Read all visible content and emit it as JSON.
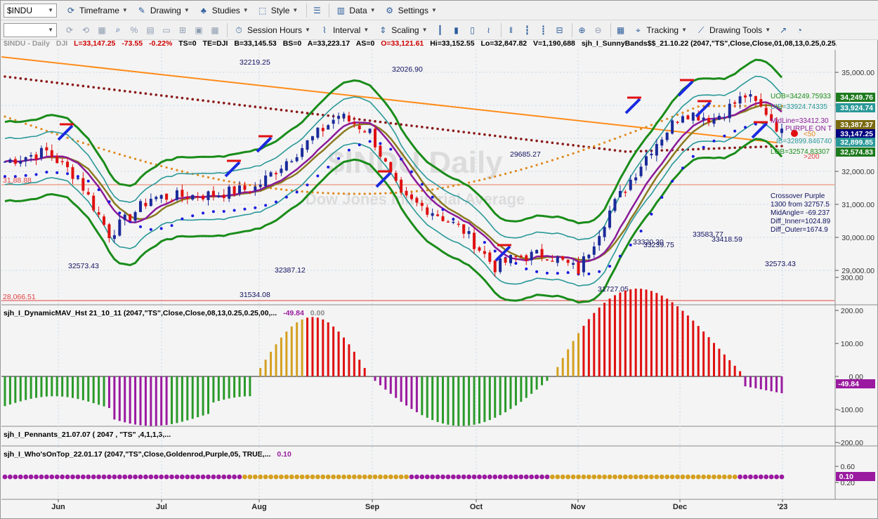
{
  "toolbar1": {
    "symbol": "$INDU",
    "timeframe": "Timeframe",
    "drawing": "Drawing",
    "studies": "Studies",
    "style": "Style",
    "data": "Data",
    "settings": "Settings"
  },
  "toolbar2": {
    "session_hours": "Session Hours",
    "interval": "Interval",
    "scaling": "Scaling",
    "tracking": "Tracking",
    "drawing_tools": "Drawing Tools"
  },
  "infobar": {
    "symbol": "$INDU - Daily",
    "exchange": "DJI",
    "last": "L=33,147.25",
    "chg": "-73.55",
    "pct": "-0.22%",
    "ts": "TS=0",
    "te": "TE=DJI",
    "b": "B=33,145.53",
    "bs": "BS=0",
    "a": "A=33,223.17",
    "as": "AS=0",
    "open": "O=33,121.61",
    "hi": "Hi=33,152.55",
    "lo": "Lo=32,847.82",
    "vol": "V=1,190,688",
    "study": "sjh_I_SunnyBands$$_21.10.22 (2047,\"TS\",Close,Close,01,08,13,0.25,0.25,..."
  },
  "watermark": {
    "title": "$INDU Daily",
    "subtitle": "Dow Jones Industrial Average"
  },
  "price_axis": {
    "ticks": [
      "35,000.00",
      "34,000.00",
      "33,000.00",
      "32,000.00",
      "31,000.00",
      "30,000.00",
      "29,000.00"
    ],
    "labels": [
      {
        "text": "34,249.76",
        "color": "#1e7a1e"
      },
      {
        "text": "33,924.74",
        "color": "#2a9898"
      },
      {
        "text": "33,387.37",
        "color": "#7a6a10"
      },
      {
        "text": "33,147.25",
        "color": "#000080"
      },
      {
        "text": "32,899.85",
        "color": "#2a9898"
      },
      {
        "text": "32,574.83",
        "color": "#1e7a1e"
      }
    ]
  },
  "annotations": {
    "peaks": [
      "32219.25",
      "32026.90",
      "29685.27",
      "32387.12",
      "31534.08",
      "31727.05",
      "33320.30",
      "33239.75",
      "33583.77",
      "33418.59",
      "32573.43"
    ],
    "overlap_label": "32573.43",
    "left_level": "28,066.51",
    "left_level2": "31,88.88",
    "right_box": [
      "Crossover Purple",
      "1300 from 32757.5",
      "MidAngle= -69.237",
      "Diff_Inner=1024.89",
      "Diff_Outer=1674.9"
    ],
    "band_labels": [
      "UOB=34249.75933",
      "UIB=33924.74335",
      "MidLine=33412.30",
      "PURPLE ON T",
      "IB=32899.846740",
      "LOB=32574.83307"
    ],
    "small_marks": [
      "<50",
      ">200"
    ]
  },
  "indicator1": {
    "title": "sjh_I_DynamicMAV_Hst 21_10_11 (2047,\"TS\",Close,Close,08,13,0.25,0.25,00,...",
    "value": "-49.84",
    "value2": "0.00",
    "ticks": [
      "300.00",
      "200.00",
      "100.00",
      "0.00",
      "-100.00",
      "-200.00"
    ],
    "badge": "-49.84"
  },
  "indicator2": {
    "title": "sjh_I_Pennants_21.07.07 ( 2047 , \"TS\" ,4,1,1,3,..."
  },
  "indicator3": {
    "title": "sjh_I_Who'sOnTop_22.01.17 (2047,\"TS\",Close,Goldenrod,Purple,05, TRUE,...",
    "value": "0.10",
    "ticks": [
      "0.60",
      "0.20"
    ],
    "badge": "0.10"
  },
  "time_axis": {
    "labels": [
      "Jun",
      "Jul",
      "Aug",
      "Sep",
      "Oct",
      "Nov",
      "Dec",
      "'23"
    ]
  },
  "colors": {
    "green": "#1a8c1a",
    "teal": "#2a9898",
    "purple": "#8a1a9a",
    "olive": "#8a7a20",
    "orange": "#ff8c1a",
    "maroon": "#8b1a1a",
    "goldenrod": "#d4a020",
    "red_bar": "#e01010",
    "green_bar": "#2a9a2a",
    "purple_bar": "#9a1aa0",
    "up_candle": "#1a2a9a",
    "down_candle": "#e01010"
  }
}
